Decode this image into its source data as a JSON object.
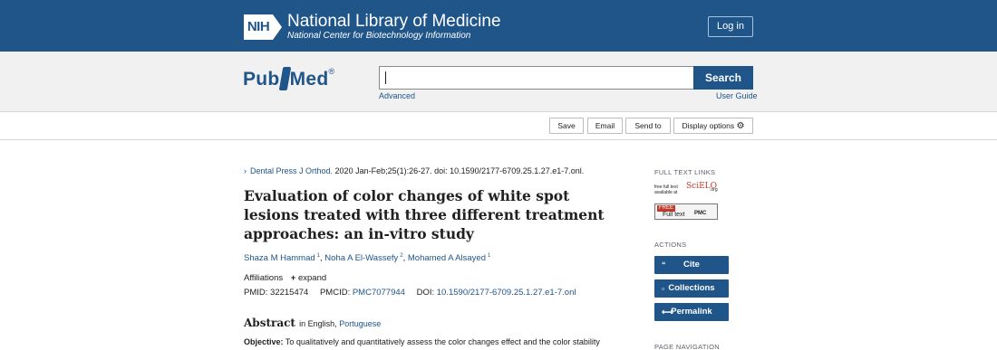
{
  "nih": {
    "badge": "NIH",
    "title": "National Library of Medicine",
    "subtitle": "National Center for Biotechnology Information",
    "login_label": "Log in"
  },
  "search": {
    "logo_left": "Pub",
    "logo_right": "Med",
    "logo_reg": "®",
    "placeholder": "",
    "button_label": "Search",
    "advanced_label": "Advanced",
    "user_guide_label": "User Guide"
  },
  "toolbar": {
    "save_label": "Save",
    "email_label": "Email",
    "send_label": "Send to",
    "display_label": "Display options",
    "gear_icon": "gear-icon"
  },
  "article": {
    "journal": "Dental Press J Orthod.",
    "citation_rest": " 2020 Jan-Feb;25(1):26-27. doi: 10.1590/2177-6709.25.1.27.e1-7.onl.",
    "title": "Evaluation of color changes of white spot lesions treated with three different treatment approaches: an in-vitro study",
    "authors": [
      {
        "name": "Shaza M Hammad",
        "sup": "1"
      },
      {
        "name": "Noha A El-Wassefy",
        "sup": "2"
      },
      {
        "name": "Mohamed A Alsayed",
        "sup": "1"
      }
    ],
    "affiliations_label": "Affiliations",
    "expand_label": "expand",
    "pmid_label": "PMID:",
    "pmid_value": "32215474",
    "pmcid_label": "PMCID:",
    "pmcid_value": "PMC7077944",
    "doi_label": "DOI:",
    "doi_value": "10.1590/2177-6709.25.1.27.e1-7.onl",
    "abstract_heading": "Abstract",
    "abstract_lang_prefix": "in English,",
    "abstract_lang_alt": "Portuguese",
    "objective_label": "Objective:",
    "objective_text": "To qualitatively and quantitatively assess the color changes effect and the color stability"
  },
  "sidebar": {
    "full_text_heading": "FULL TEXT LINKS",
    "scielo_small": "free full text available at",
    "scielo_brand": "SciELO",
    "scielo_org": ".org",
    "pmc_free": "FREE",
    "pmc_fulltext": "Full text",
    "pmc_label": "PMC",
    "actions_heading": "ACTIONS",
    "cite_label": "Cite",
    "collections_label": "Collections",
    "permalink_label": "Permalink",
    "page_nav_heading": "PAGE NAVIGATION"
  },
  "colors": {
    "brand": "#20558a",
    "link": "#20558a",
    "text": "#212121"
  }
}
